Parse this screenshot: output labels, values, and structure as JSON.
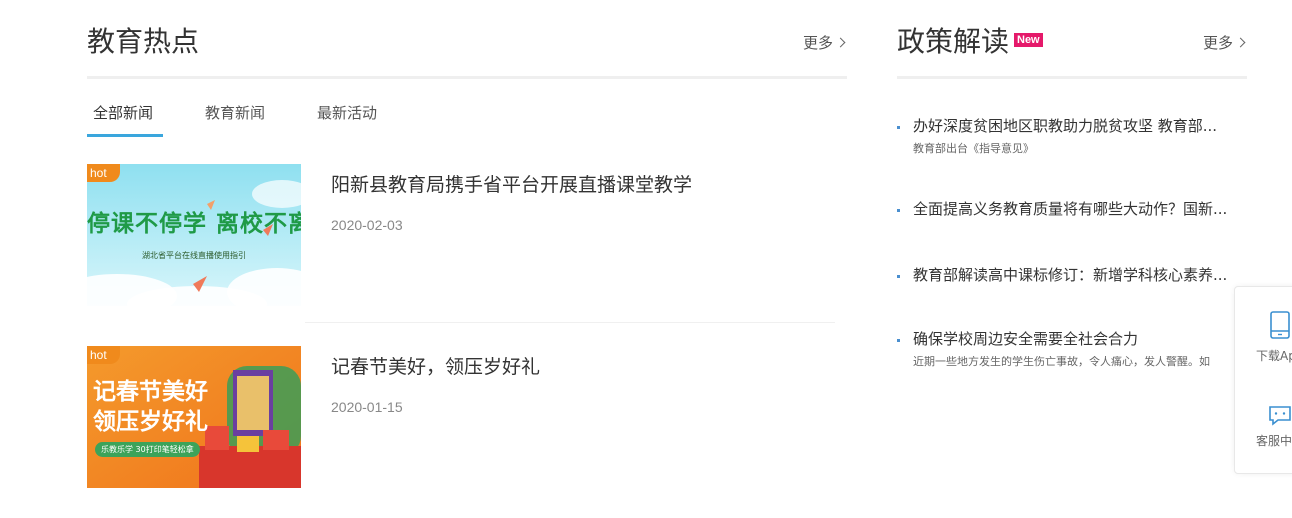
{
  "education_hot": {
    "title": "教育热点",
    "more": "更多",
    "tabs": [
      "全部新闻",
      "教育新闻",
      "最新活动"
    ],
    "items": [
      {
        "badge": "hot",
        "title": "阳新县教育局携手省平台开展直播课堂教学",
        "date": "2020-02-03",
        "image_text": "停课不停学  离校不离教",
        "image_subtext": "湖北省平台在线直播使用指引"
      },
      {
        "badge": "hot",
        "title": "记春节美好，领压岁好礼",
        "date": "2020-01-15",
        "image_text_1": "记春节美好",
        "image_text_2": "领压岁好礼",
        "image_subtext": "乐教乐学 30打印笔轻松拿"
      }
    ]
  },
  "policy": {
    "title": "政策解读",
    "badge": "New",
    "more": "更多",
    "items": [
      {
        "title": "办好深度贫困地区职教助力脱贫攻坚 教育部...",
        "summary": "教育部出台《指导意见》"
      },
      {
        "title": "全面提高义务教育质量将有哪些大动作？国新...",
        "summary": ""
      },
      {
        "title": "教育部解读高中课标修订：新增学科核心素养...",
        "summary": ""
      },
      {
        "title": "确保学校周边安全需要全社会合力",
        "summary": "近期一些地方发生的学生伤亡事故，令人痛心，发人警醒。如"
      }
    ]
  },
  "float_panel": {
    "download_app": "下载Ap",
    "customer_service": "客服中"
  },
  "colors": {
    "accent": "#3aa6dd",
    "new_badge": "#e5196a",
    "hot_badge": "#f08a1c"
  }
}
